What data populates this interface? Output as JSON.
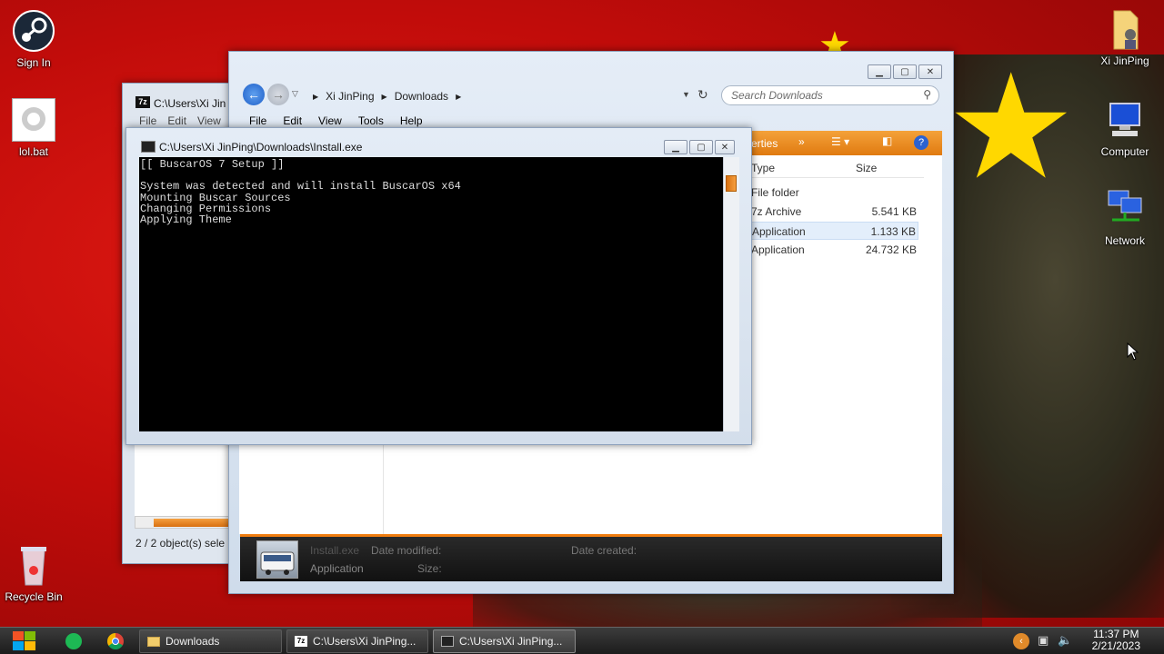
{
  "desktop": {
    "icons": [
      {
        "label": "Sign In"
      },
      {
        "label": "lol.bat"
      },
      {
        "label": "Recycle Bin"
      },
      {
        "label": "Xi JinPing"
      },
      {
        "label": "Computer"
      },
      {
        "label": "Network"
      }
    ]
  },
  "explorer": {
    "breadcrumb": [
      "Xi JinPing",
      "Downloads"
    ],
    "menu": [
      "File",
      "Edit",
      "View",
      "Tools",
      "Help"
    ],
    "search_placeholder": "Search Downloads",
    "toolbar_label": "erties",
    "columns": {
      "type": "Type",
      "size": "Size"
    },
    "files": [
      {
        "type": "File folder",
        "size": ""
      },
      {
        "type": "7z Archive",
        "size": "5.541 KB"
      },
      {
        "type": "Application",
        "size": "1.133 KB",
        "selected": true
      },
      {
        "type": "Application",
        "size": "24.732 KB"
      }
    ],
    "details": {
      "name": "Install.exe",
      "kind": "Application",
      "modified_label": "Date modified:",
      "created_label": "Date created:",
      "size_label": "Size:"
    }
  },
  "sevenz": {
    "title": "C:\\Users\\Xi Jin",
    "menu": [
      "File",
      "Edit",
      "View"
    ],
    "status": "2 / 2 object(s) sele"
  },
  "cmd": {
    "title": "C:\\Users\\Xi JinPing\\Downloads\\Install.exe",
    "output": "[[ BuscarOS 7 Setup ]]\n\nSystem was detected and will install BuscarOS x64\nMounting Buscar Sources\nChanging Permissions\nApplying Theme"
  },
  "taskbar": {
    "items": [
      {
        "label": "Downloads"
      },
      {
        "label": "C:\\Users\\Xi JinPing..."
      },
      {
        "label": "C:\\Users\\Xi JinPing..."
      }
    ],
    "clock_time": "11:37 PM",
    "clock_date": "2/21/2023"
  },
  "colors": {
    "accent_orange": "#f07d10",
    "desktop_red": "#d11410",
    "star_yellow": "#ffd800"
  }
}
